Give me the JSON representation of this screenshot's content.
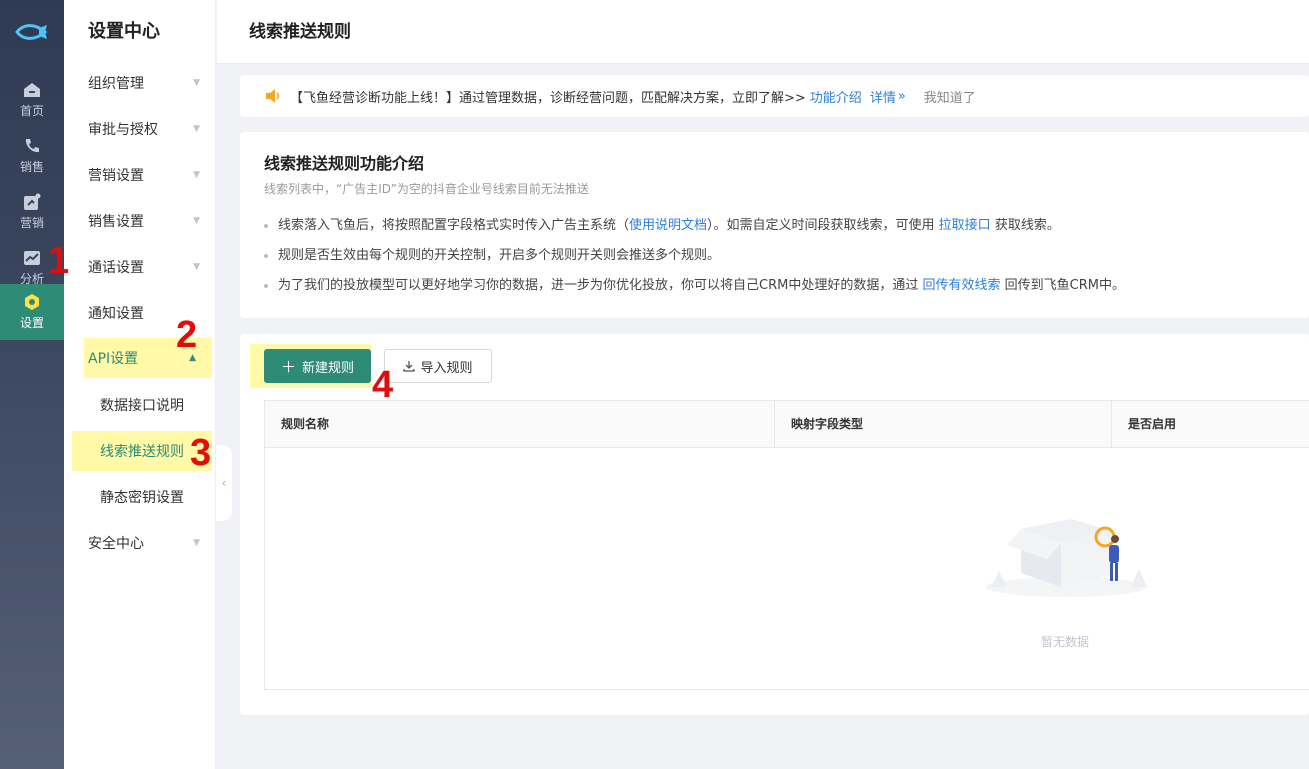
{
  "rail": {
    "items": [
      {
        "label": "首页",
        "icon": "home-icon"
      },
      {
        "label": "销售",
        "icon": "phone-icon"
      },
      {
        "label": "营销",
        "icon": "marketing-icon"
      },
      {
        "label": "分析",
        "icon": "chart-icon"
      },
      {
        "label": "设置",
        "icon": "settings-icon",
        "active": true
      }
    ]
  },
  "menu": {
    "title": "设置中心",
    "items": [
      {
        "label": "组织管理"
      },
      {
        "label": "审批与授权"
      },
      {
        "label": "营销设置"
      },
      {
        "label": "销售设置"
      },
      {
        "label": "通话设置"
      },
      {
        "label": "通知设置"
      },
      {
        "label": "API设置"
      },
      {
        "label": "数据接口说明"
      },
      {
        "label": "线索推送规则"
      },
      {
        "label": "静态密钥设置"
      },
      {
        "label": "安全中心"
      }
    ]
  },
  "header": {
    "title": "线索推送规则"
  },
  "notice": {
    "text": "【飞鱼经营诊断功能上线！】通过管理数据，诊断经营问题，匹配解决方案，立即了解>>",
    "link1": "功能介绍",
    "link2": "详情",
    "link2_arrow": "»",
    "dismiss": "我知道了"
  },
  "intro": {
    "title": "线索推送规则功能介绍",
    "subtitle": "线索列表中，“广告主ID”为空的抖音企业号线索目前无法推送",
    "b1_pre": "线索落入飞鱼后，将按照配置字段格式实时传入广告主系统（",
    "b1_link1": "使用说明文档",
    "b1_mid": "）。如需自定义时间段获取线索，可使用 ",
    "b1_link2": "拉取接口",
    "b1_post": " 获取线索。",
    "b2": "规则是否生效由每个规则的开关控制，开启多个规则开关则会推送多个规则。",
    "b3_pre": "为了我们的投放模型可以更好地学习你的数据，进一步为你优化投放，你可以将自己CRM中处理好的数据，通过 ",
    "b3_link": "回传有效线索",
    "b3_post": " 回传到飞鱼CRM中。"
  },
  "toolbar": {
    "new_label": "新建规则",
    "import_label": "导入规则"
  },
  "table": {
    "columns": [
      "规则名称",
      "映射字段类型",
      "是否启用"
    ],
    "empty_text": "暂无数据"
  },
  "annotations": [
    "1",
    "2",
    "3",
    "4"
  ],
  "colors": {
    "accent": "#2e8b76",
    "link": "#2f7fd6",
    "highlight": "#fff9a8",
    "annotation": "#e30c0c"
  }
}
